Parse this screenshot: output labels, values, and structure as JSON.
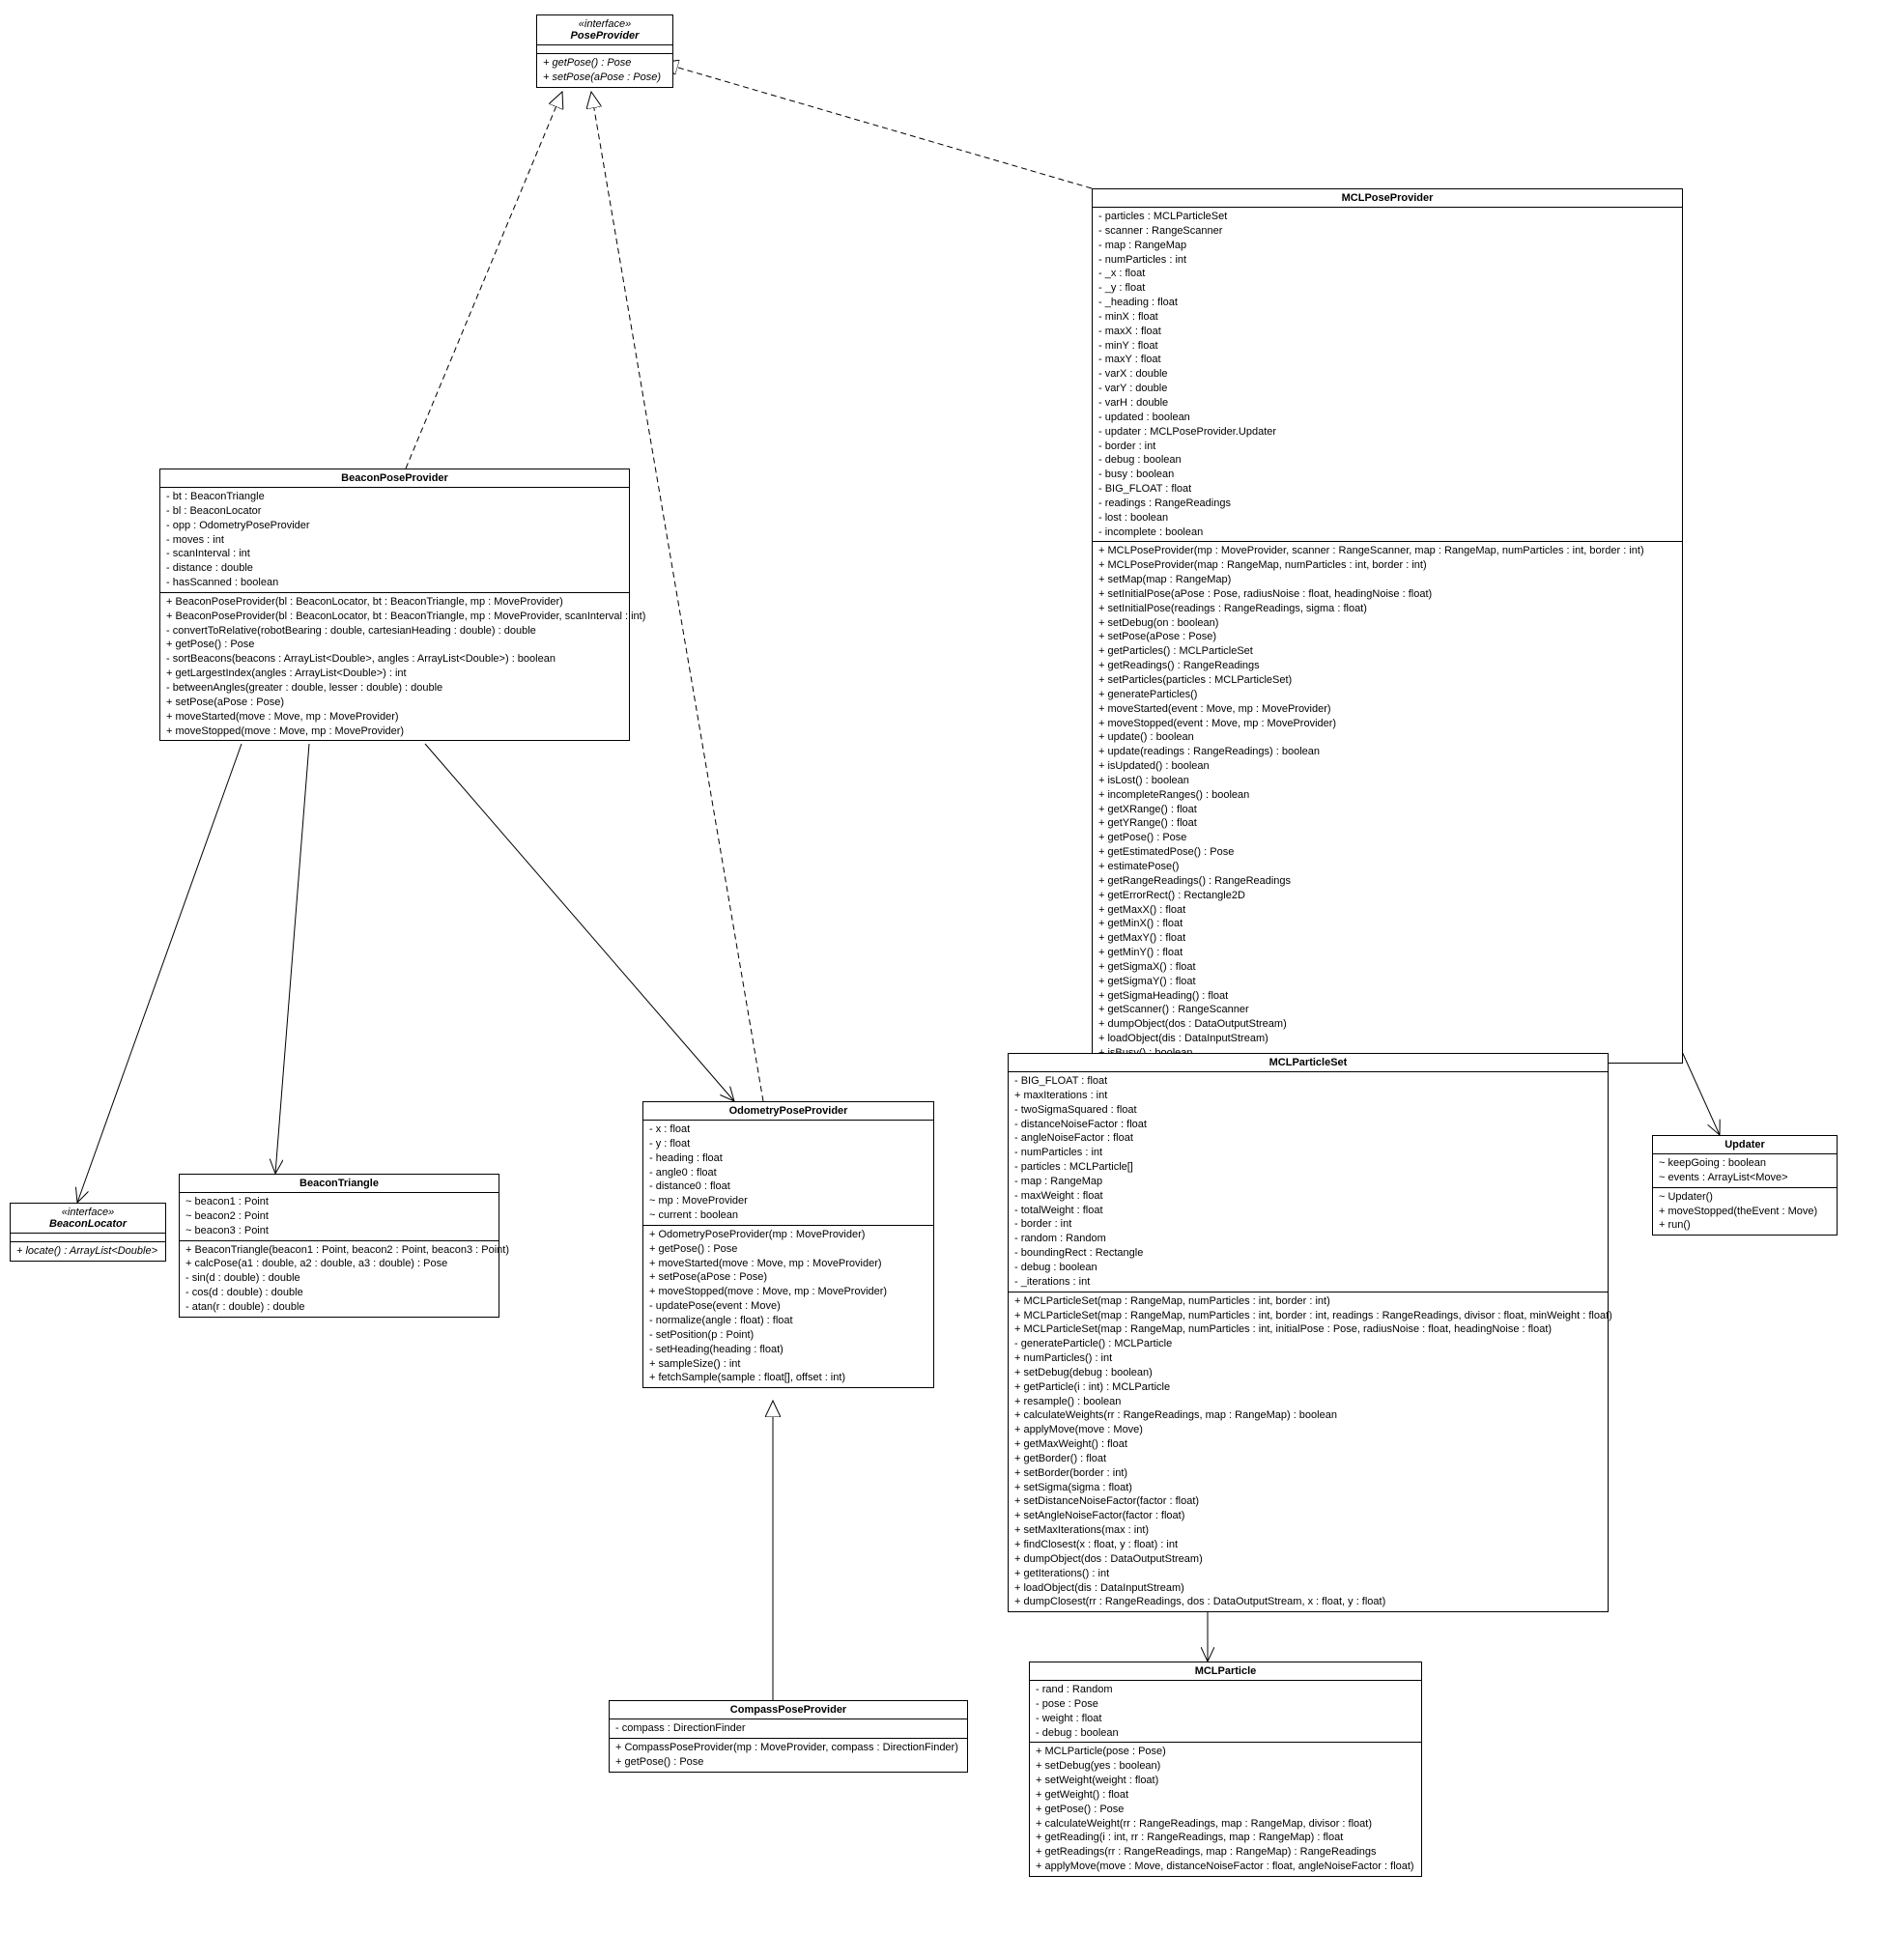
{
  "classes": {
    "PoseProvider": {
      "stereotype": "«interface»",
      "name": "PoseProvider",
      "methods": [
        "+ getPose() : Pose",
        "+ setPose(aPose : Pose)"
      ]
    },
    "MCLPoseProvider": {
      "name": "MCLPoseProvider",
      "attrs": [
        "- particles : MCLParticleSet",
        "- scanner : RangeScanner",
        "- map : RangeMap",
        "- numParticles : int",
        "- _x : float",
        "- _y : float",
        "- _heading : float",
        "- minX : float",
        "- maxX : float",
        "- minY : float",
        "- maxY : float",
        "- varX : double",
        "- varY : double",
        "- varH : double",
        "- updated : boolean",
        "- updater : MCLPoseProvider.Updater",
        "- border : int",
        "- debug : boolean",
        "- busy : boolean",
        "- BIG_FLOAT : float",
        "- readings : RangeReadings",
        "- lost : boolean",
        "- incomplete : boolean"
      ],
      "methods": [
        "+ MCLPoseProvider(mp : MoveProvider, scanner : RangeScanner, map : RangeMap, numParticles : int, border : int)",
        "+ MCLPoseProvider(map : RangeMap, numParticles : int, border : int)",
        "+ setMap(map : RangeMap)",
        "+ setInitialPose(aPose : Pose, radiusNoise : float, headingNoise : float)",
        "+ setInitialPose(readings : RangeReadings, sigma : float)",
        "+ setDebug(on : boolean)",
        "+ setPose(aPose : Pose)",
        "+ getParticles() : MCLParticleSet",
        "+ getReadings() : RangeReadings",
        "+ setParticles(particles : MCLParticleSet)",
        "+ generateParticles()",
        "+ moveStarted(event : Move, mp : MoveProvider)",
        "+ moveStopped(event : Move, mp : MoveProvider)",
        "+ update() : boolean",
        "+ update(readings : RangeReadings) : boolean",
        "+ isUpdated() : boolean",
        "+ isLost() : boolean",
        "+ incompleteRanges() : boolean",
        "+ getXRange() : float",
        "+ getYRange() : float",
        "+ getPose() : Pose",
        "+ getEstimatedPose() : Pose",
        "+ estimatePose()",
        "+ getRangeReadings() : RangeReadings",
        "+ getErrorRect() : Rectangle2D",
        "+ getMaxX() : float",
        "+ getMinX() : float",
        "+ getMaxY() : float",
        "+ getMinY() : float",
        "+ getSigmaX() : float",
        "+ getSigmaY() : float",
        "+ getSigmaHeading() : float",
        "+ getScanner() : RangeScanner",
        "+ dumpObject(dos : DataOutputStream)",
        "+ loadObject(dis : DataInputStream)",
        "+ isBusy() : boolean"
      ]
    },
    "BeaconPoseProvider": {
      "name": "BeaconPoseProvider",
      "attrs": [
        "- bt : BeaconTriangle",
        "- bl : BeaconLocator",
        "- opp : OdometryPoseProvider",
        "- moves : int",
        "- scanInterval : int",
        "- distance : double",
        "- hasScanned : boolean"
      ],
      "methods": [
        "+ BeaconPoseProvider(bl : BeaconLocator, bt : BeaconTriangle, mp : MoveProvider)",
        "+ BeaconPoseProvider(bl : BeaconLocator, bt : BeaconTriangle, mp : MoveProvider, scanInterval : int)",
        "- convertToRelative(robotBearing : double, cartesianHeading : double) : double",
        "+ getPose() : Pose",
        "- sortBeacons(beacons : ArrayList<Double>, angles : ArrayList<Double>) : boolean",
        "+ getLargestIndex(angles : ArrayList<Double>) : int",
        "- betweenAngles(greater : double, lesser : double) : double",
        "+ setPose(aPose : Pose)",
        "+ moveStarted(move : Move, mp : MoveProvider)",
        "+ moveStopped(move : Move, mp : MoveProvider)"
      ]
    },
    "BeaconLocator": {
      "stereotype": "«interface»",
      "name": "BeaconLocator",
      "methods": [
        "+ locate() : ArrayList<Double>"
      ]
    },
    "BeaconTriangle": {
      "name": "BeaconTriangle",
      "attrs": [
        "~ beacon1 : Point",
        "~ beacon2 : Point",
        "~ beacon3 : Point"
      ],
      "methods": [
        "+ BeaconTriangle(beacon1 : Point, beacon2 : Point, beacon3 : Point)",
        "+ calcPose(a1 : double, a2 : double, a3 : double) : Pose",
        "- sin(d : double) : double",
        "- cos(d : double) : double",
        "- atan(r : double) : double"
      ]
    },
    "OdometryPoseProvider": {
      "name": "OdometryPoseProvider",
      "attrs": [
        "- x : float",
        "- y : float",
        "- heading : float",
        "- angle0 : float",
        "- distance0 : float",
        "~ mp : MoveProvider",
        "~ current : boolean"
      ],
      "methods": [
        "+ OdometryPoseProvider(mp : MoveProvider)",
        "+ getPose() : Pose",
        "+ moveStarted(move : Move, mp : MoveProvider)",
        "+ setPose(aPose : Pose)",
        "+ moveStopped(move : Move, mp : MoveProvider)",
        "- updatePose(event : Move)",
        "- normalize(angle : float) : float",
        "- setPosition(p : Point)",
        "- setHeading(heading : float)",
        "+ sampleSize() : int",
        "+ fetchSample(sample : float[], offset : int)"
      ]
    },
    "CompassPoseProvider": {
      "name": "CompassPoseProvider",
      "attrs": [
        "- compass : DirectionFinder"
      ],
      "methods": [
        "+ CompassPoseProvider(mp : MoveProvider, compass : DirectionFinder)",
        "+ getPose() : Pose"
      ]
    },
    "MCLParticleSet": {
      "name": "MCLParticleSet",
      "attrs": [
        "- BIG_FLOAT : float",
        "+ maxIterations : int",
        "- twoSigmaSquared : float",
        "- distanceNoiseFactor : float",
        "- angleNoiseFactor : float",
        "- numParticles : int",
        "- particles : MCLParticle[]",
        "- map : RangeMap",
        "- maxWeight : float",
        "- totalWeight : float",
        "- border : int",
        "- random : Random",
        "- boundingRect : Rectangle",
        "- debug : boolean",
        "- _iterations : int"
      ],
      "methods": [
        "+ MCLParticleSet(map : RangeMap, numParticles : int, border : int)",
        "+ MCLParticleSet(map : RangeMap, numParticles : int, border : int, readings : RangeReadings, divisor : float, minWeight : float)",
        "+ MCLParticleSet(map : RangeMap, numParticles : int, initialPose : Pose, radiusNoise : float, headingNoise : float)",
        "- generateParticle() : MCLParticle",
        "+ numParticles() : int",
        "+ setDebug(debug : boolean)",
        "+ getParticle(i : int) : MCLParticle",
        "+ resample() : boolean",
        "+ calculateWeights(rr : RangeReadings, map : RangeMap) : boolean",
        "+ applyMove(move : Move)",
        "+ getMaxWeight() : float",
        "+ getBorder() : float",
        "+ setBorder(border : int)",
        "+ setSigma(sigma : float)",
        "+ setDistanceNoiseFactor(factor : float)",
        "+ setAngleNoiseFactor(factor : float)",
        "+ setMaxIterations(max : int)",
        "+ findClosest(x : float, y : float) : int",
        "+ dumpObject(dos : DataOutputStream)",
        "+ getIterations() : int",
        "+ loadObject(dis : DataInputStream)",
        "+ dumpClosest(rr : RangeReadings, dos : DataOutputStream, x : float, y : float)"
      ]
    },
    "Updater": {
      "name": "Updater",
      "attrs": [
        "~ keepGoing : boolean",
        "~ events : ArrayList<Move>"
      ],
      "methods": [
        "~ Updater()",
        "+ moveStopped(theEvent : Move)",
        "+ run()"
      ]
    },
    "MCLParticle": {
      "name": "MCLParticle",
      "attrs": [
        "- rand : Random",
        "- pose : Pose",
        "- weight : float",
        "- debug : boolean"
      ],
      "methods": [
        "+ MCLParticle(pose : Pose)",
        "+ setDebug(yes : boolean)",
        "+ setWeight(weight : float)",
        "+ getWeight() : float",
        "+ getPose() : Pose",
        "+ calculateWeight(rr : RangeReadings, map : RangeMap, divisor : float)",
        "+ getReading(i : int, rr : RangeReadings, map : RangeMap) : float",
        "+ getReadings(rr : RangeReadings, map : RangeMap) : RangeReadings",
        "+ applyMove(move : Move, distanceNoiseFactor : float, angleNoiseFactor : float)"
      ]
    }
  }
}
